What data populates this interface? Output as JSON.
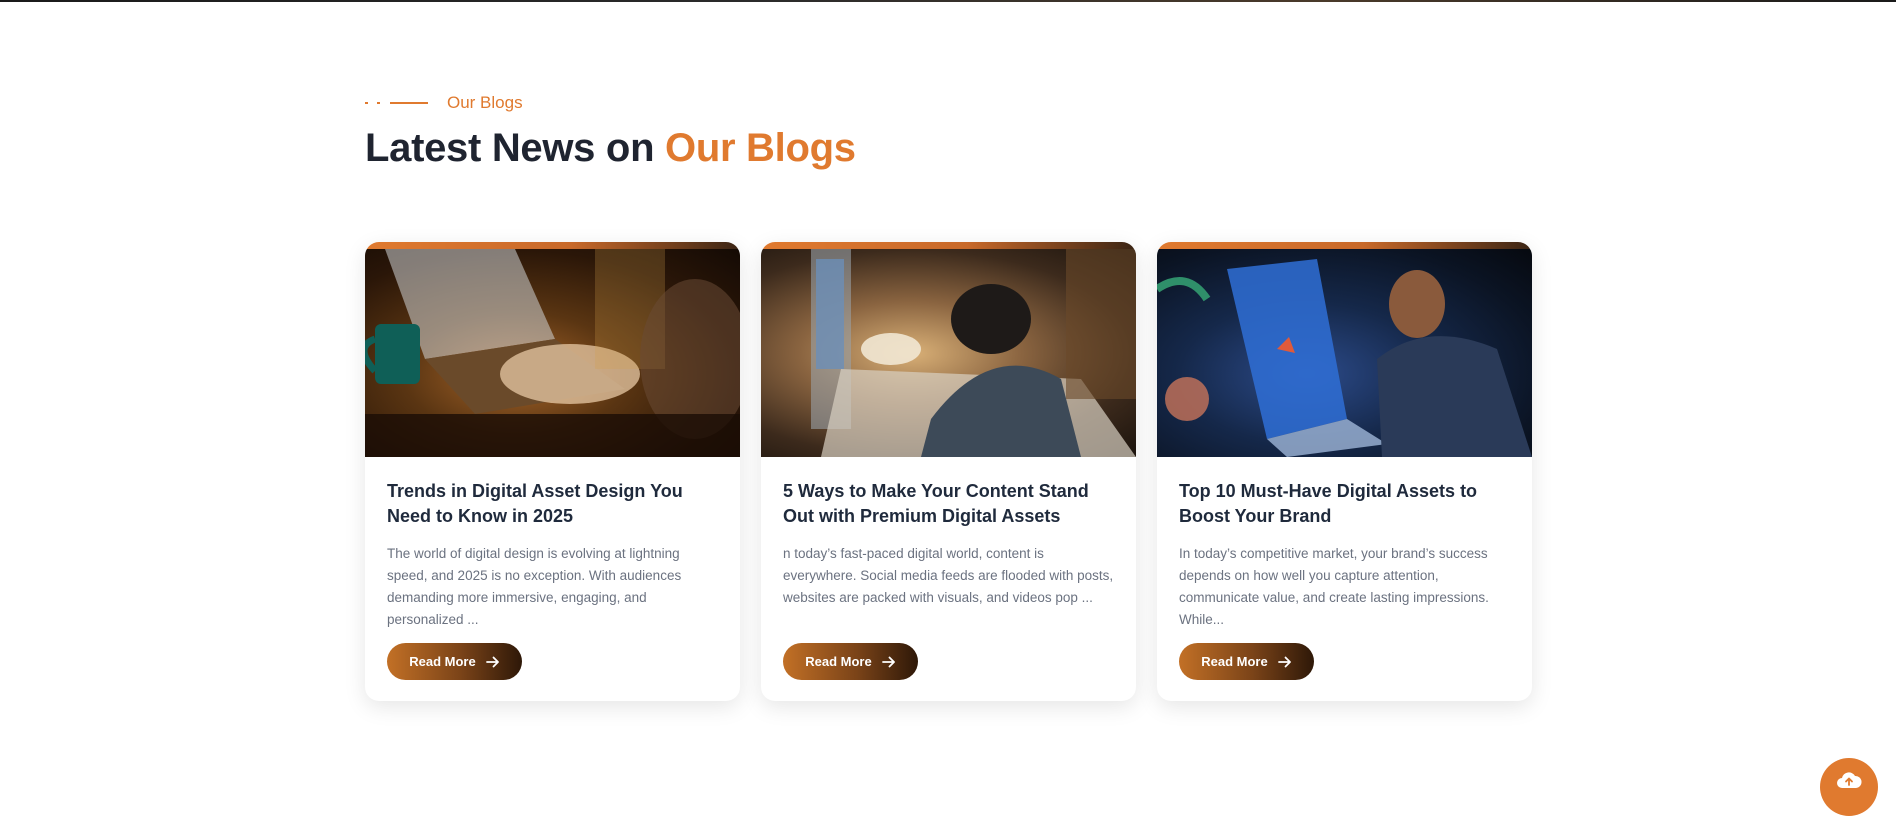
{
  "section": {
    "eyebrow": "Our Blogs",
    "title_prefix": "Latest News on ",
    "title_accent": "Our Blogs"
  },
  "posts": [
    {
      "title": "Trends in Digital Asset Design You Need to Know in 2025",
      "excerpt": "The world of digital design is evolving at lightning speed, and 2025 is no exception. With audiences demanding more immersive, engaging, and personalized ...",
      "button_label": "Read More",
      "image_subject": "laptop-typing-coffee-mug"
    },
    {
      "title": "5 Ways to Make Your Content Stand Out with Premium Digital Assets",
      "excerpt": "n today’s fast-paced digital world, content is everywhere. Social media feeds are flooded with posts, websites are packed with visuals, and videos pop ...",
      "button_label": "Read More",
      "image_subject": "person-drawing-at-desk"
    },
    {
      "title": "Top 10 Must-Have Digital Assets to Boost Your Brand",
      "excerpt": "In today’s competitive market, your brand’s success depends on how well you capture attention, communicate value, and create lasting impressions. While...",
      "button_label": "Read More",
      "image_subject": "person-drawing-on-tablet"
    }
  ],
  "colors": {
    "accent": "#e07a2f",
    "heading": "#1f2430",
    "card_title": "#1f2a3c",
    "body_text": "#6b7280",
    "button_gradient_start": "#c27026",
    "button_gradient_end": "#2e1808"
  },
  "icons": {
    "button_arrow": "arrow-right-icon",
    "fab": "cloud-upload-icon"
  }
}
